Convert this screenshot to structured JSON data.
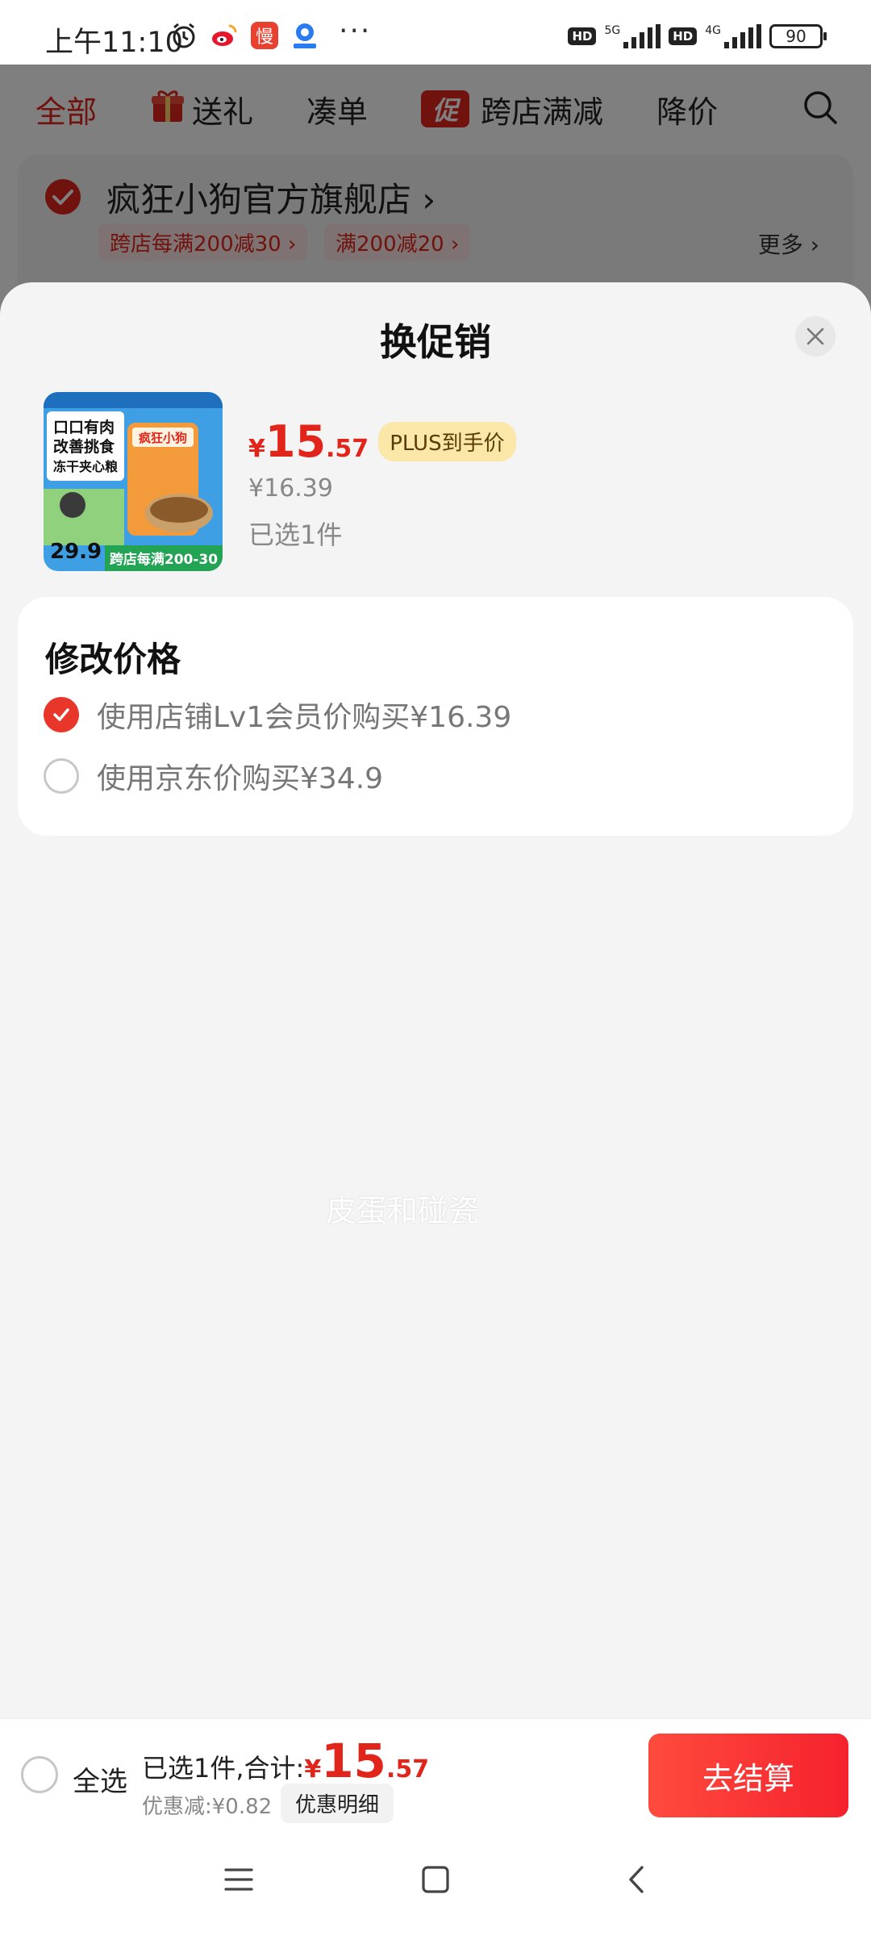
{
  "status_bar": {
    "time": "上午11:10",
    "network_1": "5G",
    "network_2": "4G",
    "hd": "HD",
    "battery": "90",
    "more": "···"
  },
  "background_page": {
    "tabs": [
      {
        "label": "全部",
        "active": true
      },
      {
        "label": "送礼",
        "active": false
      },
      {
        "label": "凑单",
        "active": false
      },
      {
        "label": "跨店满减",
        "active": false
      },
      {
        "label": "降价",
        "active": false
      }
    ],
    "promo_badge": "促",
    "store_name": "疯狂小狗官方旗舰店 ›",
    "store_tags": [
      "跨店每满200减30 ›",
      "满200减20 ›"
    ],
    "more_label": "更多 ›"
  },
  "sheet": {
    "title": "换促销",
    "product": {
      "currency": "¥",
      "price_int": "15",
      "price_dec": ".57",
      "plus_badge": "PLUS到手价",
      "original_price": "¥16.39",
      "selected": "已选1件",
      "thumb_lines": [
        "口口有肉",
        "改善挑食",
        "冻干夹心粮"
      ],
      "thumb_brand": "疯狂小狗",
      "thumb_price": "29.9",
      "thumb_promo": "跨店每满200-30"
    },
    "price_card": {
      "title": "修改价格",
      "options": [
        {
          "label": "使用店铺Lv1会员价购买¥16.39",
          "checked": true
        },
        {
          "label": "使用京东价购买¥34.9",
          "checked": false
        }
      ]
    },
    "watermark": "皮蛋和碰瓷"
  },
  "bottom_bar": {
    "select_all": "全选",
    "total_label": "已选1件,合计:",
    "currency": "¥",
    "total_int": "15",
    "total_dec": ".57",
    "discount": "优惠减:¥0.82",
    "detail_button": "优惠明细",
    "checkout": "去结算"
  },
  "colors": {
    "accent": "#e1251b",
    "plus_badge_bg": "#fbe7a8",
    "sheet_bg": "#f4f4f4"
  }
}
